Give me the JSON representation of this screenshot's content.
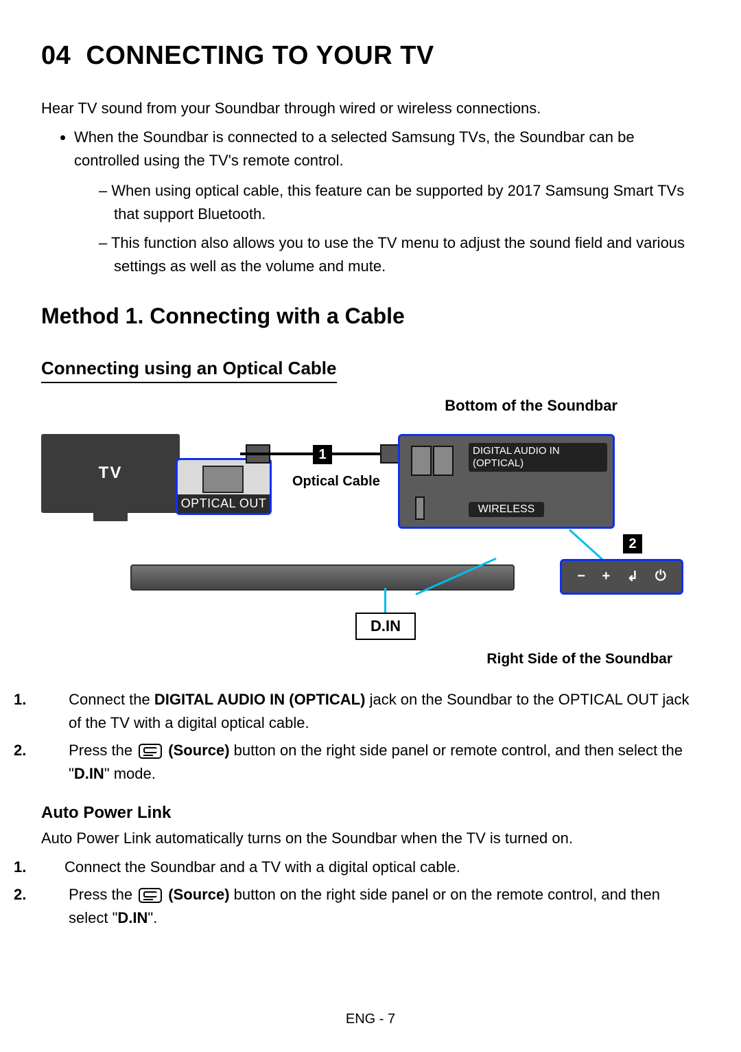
{
  "section": {
    "number": "04",
    "title": "CONNECTING TO YOUR TV"
  },
  "intro": "Hear TV sound from your Soundbar through wired or wireless connections.",
  "bullet_main": "When the Soundbar is connected to a selected Samsung TVs, the Soundbar can be controlled using the TV's remote control.",
  "dash_1": "When using optical cable, this feature can be supported by 2017 Samsung Smart TVs that support Bluetooth.",
  "dash_2": "This function also allows you to use the TV menu to adjust the sound field and various settings as well as the volume and mute.",
  "method_heading": "Method 1. Connecting with a Cable",
  "sub_heading": "Connecting using an Optical Cable",
  "diagram": {
    "top_label": "Bottom of the Soundbar",
    "tv_label": "TV",
    "optical_out": "OPTICAL OUT",
    "optical_cable": "Optical Cable",
    "callout1": "1",
    "callout2": "2",
    "port_label_optical": "DIGITAL AUDIO IN (OPTICAL)",
    "port_label_wireless": "WIRELESS",
    "side_minus": "−",
    "side_plus": "+",
    "side_source": "↲",
    "side_power": "⏻",
    "din": "D.IN",
    "bottom_right_label": "Right Side of the Soundbar"
  },
  "steps_a": {
    "s1_pre": "Connect the ",
    "s1_bold": "DIGITAL AUDIO IN (OPTICAL)",
    "s1_post": " jack on the Soundbar to the OPTICAL OUT jack of the TV with a digital optical cable.",
    "s2_pre": "Press the ",
    "s2_boldSource": "(Source)",
    "s2_mid": " button on the right side panel or remote control, and then select the \"",
    "s2_boldDin": "D.IN",
    "s2_post": "\" mode."
  },
  "apl_heading": "Auto Power Link",
  "apl_text": "Auto Power Link automatically turns on the Soundbar when the TV is turned on.",
  "steps_b": {
    "s1": "Connect the Soundbar and a TV with a digital optical cable.",
    "s2_pre": "Press the ",
    "s2_boldSource": "(Source)",
    "s2_mid": " button on the right side panel or on the remote control, and then select \"",
    "s2_boldDin": "D.IN",
    "s2_post": "\"."
  },
  "page": "ENG - 7"
}
